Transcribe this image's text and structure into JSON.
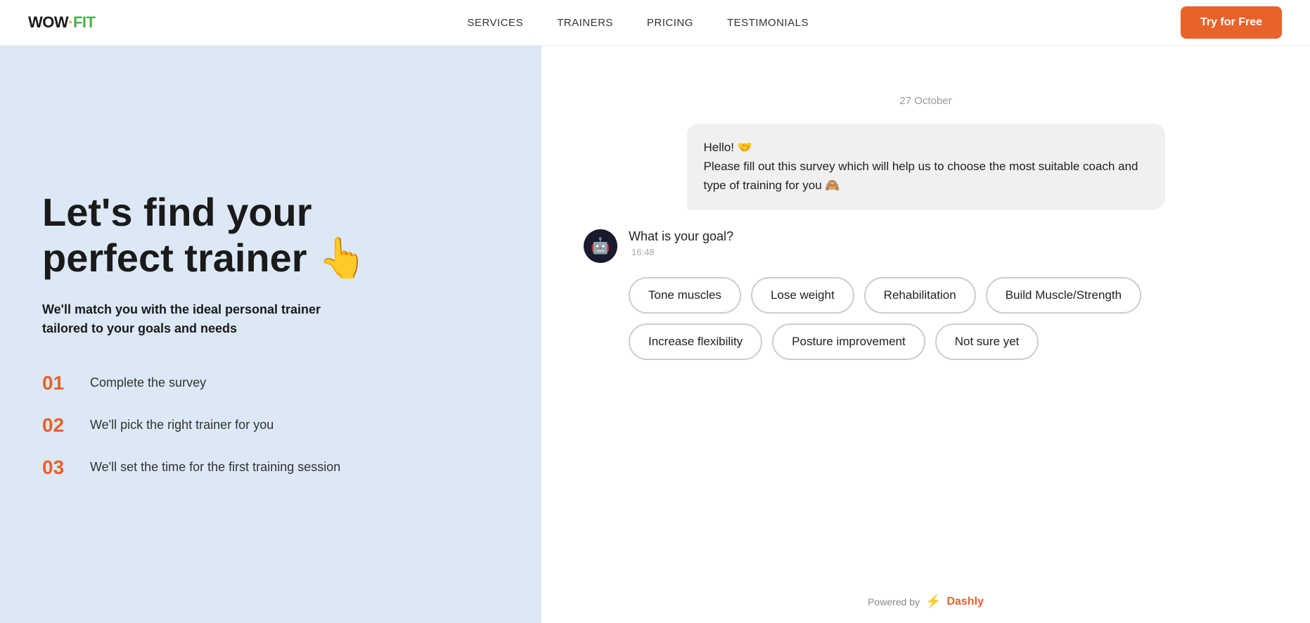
{
  "header": {
    "logo_wow": "WOW",
    "logo_separator": "·",
    "logo_fit": "FIT",
    "nav": [
      {
        "id": "services",
        "label": "SERVICES"
      },
      {
        "id": "trainers",
        "label": "TRAINERS"
      },
      {
        "id": "pricing",
        "label": "PRICING"
      },
      {
        "id": "testimonials",
        "label": "TESTIMONIALS"
      }
    ],
    "cta_label": "Try for Free"
  },
  "left": {
    "title_line1": "Let's find your",
    "title_line2": "perfect trainer 👆",
    "subtitle": "We'll match you with the ideal personal trainer tailored to your goals and needs",
    "steps": [
      {
        "number": "01",
        "text": "Complete the survey"
      },
      {
        "number": "02",
        "text": "We'll pick the right trainer for you"
      },
      {
        "number": "03",
        "text": "We'll set the time for the first training session"
      }
    ]
  },
  "right": {
    "chat_date": "27 October",
    "bot_greeting": "Hello! 🤝\nPlease fill out this survey which will help us to choose the most suitable coach and type of training for you 🙈",
    "bot_question": "What is your goal?",
    "bot_time": "16:48",
    "goal_options": [
      "Tone muscles",
      "Lose weight",
      "Rehabilitation",
      "Build Muscle/Strength",
      "Increase flexibility",
      "Posture improvement",
      "Not sure yet"
    ],
    "powered_by_label": "Powered by",
    "powered_by_brand": "Dashly"
  }
}
